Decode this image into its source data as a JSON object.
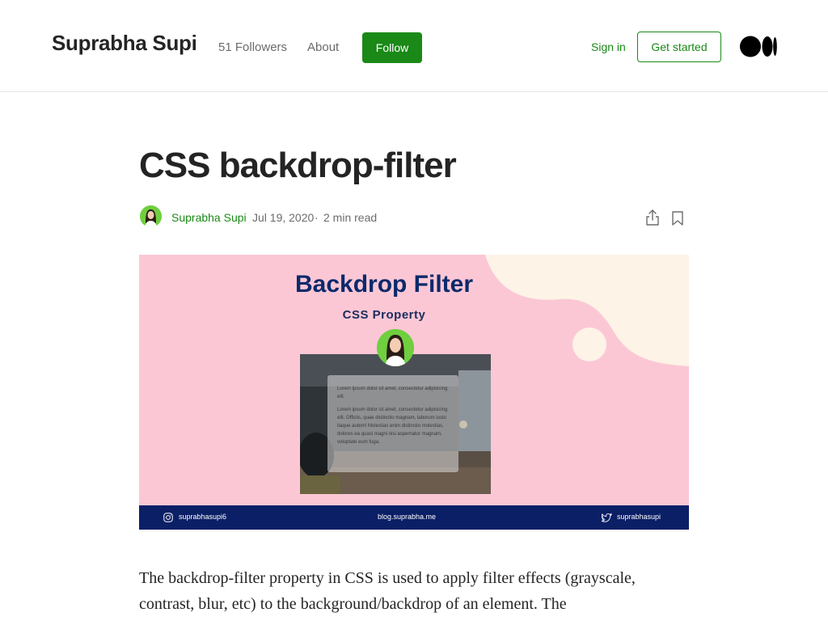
{
  "header": {
    "publication_name": "Suprabha Supi",
    "followers": "51 Followers",
    "about": "About",
    "follow": "Follow",
    "sign_in": "Sign in",
    "get_started": "Get started",
    "logo_icon": "medium-logo-icon"
  },
  "article": {
    "title": "CSS backdrop-filter",
    "author": "Suprabha Supi",
    "date": "Jul 19, 2020",
    "separator": "·",
    "read_time": "2 min read",
    "actions": {
      "share_icon": "share-icon",
      "bookmark_icon": "bookmark-icon"
    },
    "hero": {
      "title": "Backdrop Filter",
      "subtitle": "CSS Property",
      "glass_text_1": "Lorem ipsum dolor sit amet, consectetur adipisicing elit.",
      "glass_text_2": "Lorem ipsum dolor sit amet, consectetur adipisicing elit. Officiis, quae distinctio magnam, laborum iusto itaque autem! Molestias enim distinctio molestias, dolores ea quasi magni nisi aspernatur magnam, voluptate eum fuga.",
      "instagram": "suprabhasupi6",
      "blog": "blog.suprabha.me",
      "twitter": "suprabhasupi"
    },
    "body_paragraph": "The backdrop-filter property in CSS is used to apply filter effects (grayscale, contrast, blur, etc) to the background/backdrop of an element. The"
  },
  "colors": {
    "accent_green": "#1a8917",
    "hero_pink": "#fcc7d5",
    "hero_cream": "#fdf3e6",
    "hero_navy": "#0b1f66",
    "text": "#242424",
    "muted": "#6b6b6b"
  }
}
